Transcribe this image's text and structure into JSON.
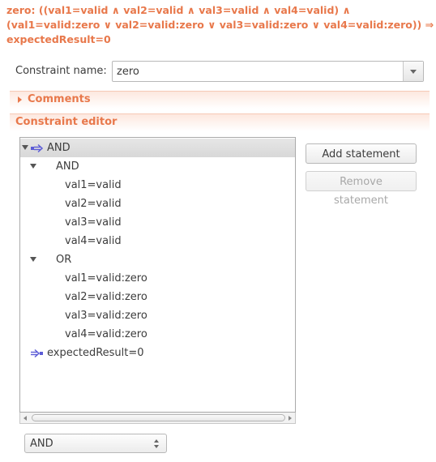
{
  "header": {
    "lines": [
      "zero: ((val1=valid ∧ val2=valid ∧ val3=valid ∧ val4=valid) ∧",
      "(val1=valid:zero ∨ val2=valid:zero ∨ val3=valid:zero ∨ val4=valid:zero)) ⇒",
      "expectedResult=0"
    ],
    "color": "#e8784b"
  },
  "constraint_name": {
    "label": "Constraint name:",
    "value": "zero"
  },
  "sections": {
    "comments": "Comments",
    "editor": "Constraint editor"
  },
  "tree": {
    "items": [
      {
        "label": "AND",
        "level": 0,
        "icon": "implication-start-icon",
        "expanded": true,
        "selected": true
      },
      {
        "label": "AND",
        "level": 1,
        "expanded": true
      },
      {
        "label": "val1=valid",
        "level": 2
      },
      {
        "label": "val2=valid",
        "level": 2
      },
      {
        "label": "val3=valid",
        "level": 2
      },
      {
        "label": "val4=valid",
        "level": 2
      },
      {
        "label": "OR",
        "level": 1,
        "expanded": true
      },
      {
        "label": "val1=valid:zero",
        "level": 2
      },
      {
        "label": "val2=valid:zero",
        "level": 2
      },
      {
        "label": "val3=valid:zero",
        "level": 2
      },
      {
        "label": "val4=valid:zero",
        "level": 2
      },
      {
        "label": "expectedResult=0",
        "level": 0,
        "icon": "implication-end-icon"
      }
    ]
  },
  "buttons": {
    "add_statement": "Add statement",
    "remove_statement": "Remove statement"
  },
  "operator_select": {
    "value": "AND"
  },
  "colors": {
    "accent": "#e8784b",
    "icon_arrow": "#5b5bd6"
  }
}
